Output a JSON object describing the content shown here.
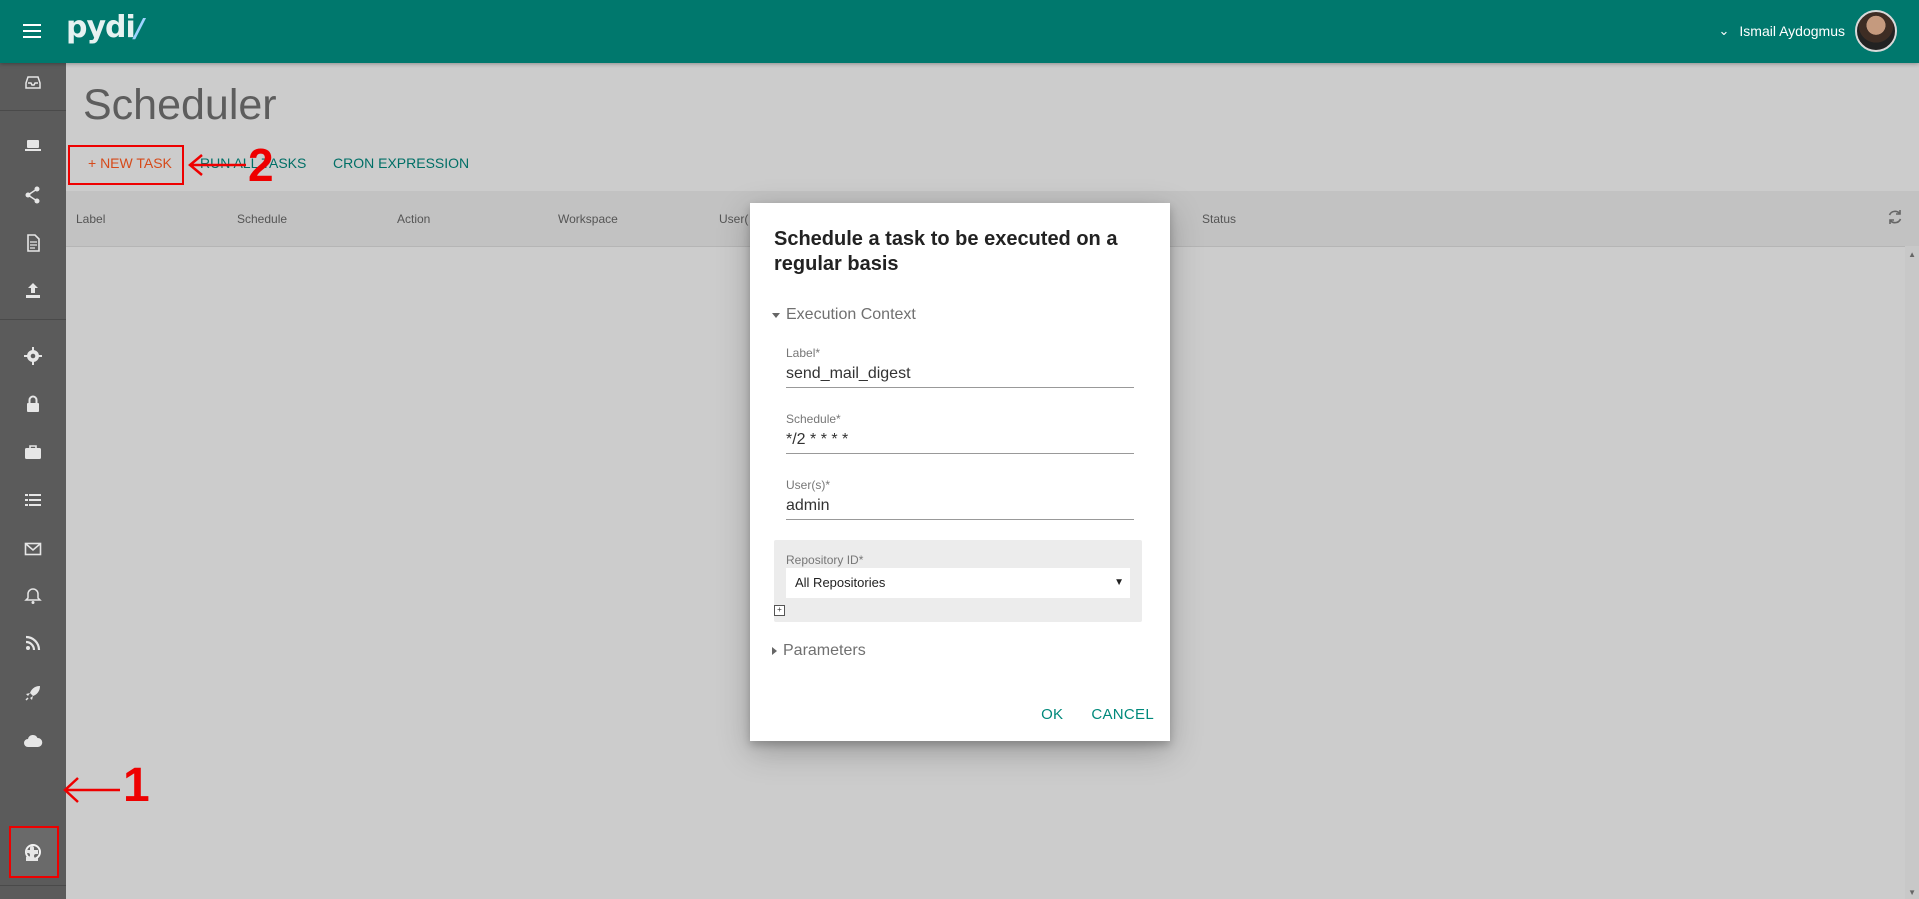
{
  "app": {
    "user_name": "Ismail Aydogmus",
    "logo_text": "pydi"
  },
  "colors": {
    "appbar": "#00786d",
    "sidebar": "#5b5b5b",
    "accent": "#00897b",
    "new_task": "#d64a1a",
    "annotation": "#ee0000"
  },
  "sidebar": {
    "items": [
      {
        "icon": "inbox-icon"
      },
      {
        "icon": "laptop-icon"
      },
      {
        "icon": "share-icon"
      },
      {
        "icon": "document-icon"
      },
      {
        "icon": "upload-icon"
      },
      {
        "icon": "gear-icon"
      },
      {
        "icon": "lock-icon"
      },
      {
        "icon": "briefcase-icon"
      },
      {
        "icon": "list-icon"
      },
      {
        "icon": "mail-icon"
      },
      {
        "icon": "bell-icon"
      },
      {
        "icon": "rss-icon"
      },
      {
        "icon": "rocket-icon"
      },
      {
        "icon": "cloud-icon"
      },
      {
        "icon": "clock-icon"
      },
      {
        "icon": "puzzle-icon"
      }
    ]
  },
  "main": {
    "title": "Scheduler",
    "toolbar": {
      "new_task": "+ NEW TASK",
      "run_all": "RUN ALL TASKS",
      "cron": "CRON EXPRESSION"
    },
    "columns": [
      "Label",
      "Schedule",
      "Action",
      "Workspace",
      "User(",
      "Status"
    ]
  },
  "annotations": {
    "one": "1",
    "two": "2"
  },
  "dialog": {
    "title": "Schedule a task to be executed on a regular basis",
    "section_context": "Execution Context",
    "label_label": "Label*",
    "label_value": "send_mail_digest",
    "schedule_label": "Schedule*",
    "schedule_value": "*/2 * * * *",
    "users_label": "User(s)*",
    "users_value": "admin",
    "repo_label": "Repository ID*",
    "repo_value": "All Repositories",
    "section_params": "Parameters",
    "ok": "OK",
    "cancel": "CANCEL"
  }
}
